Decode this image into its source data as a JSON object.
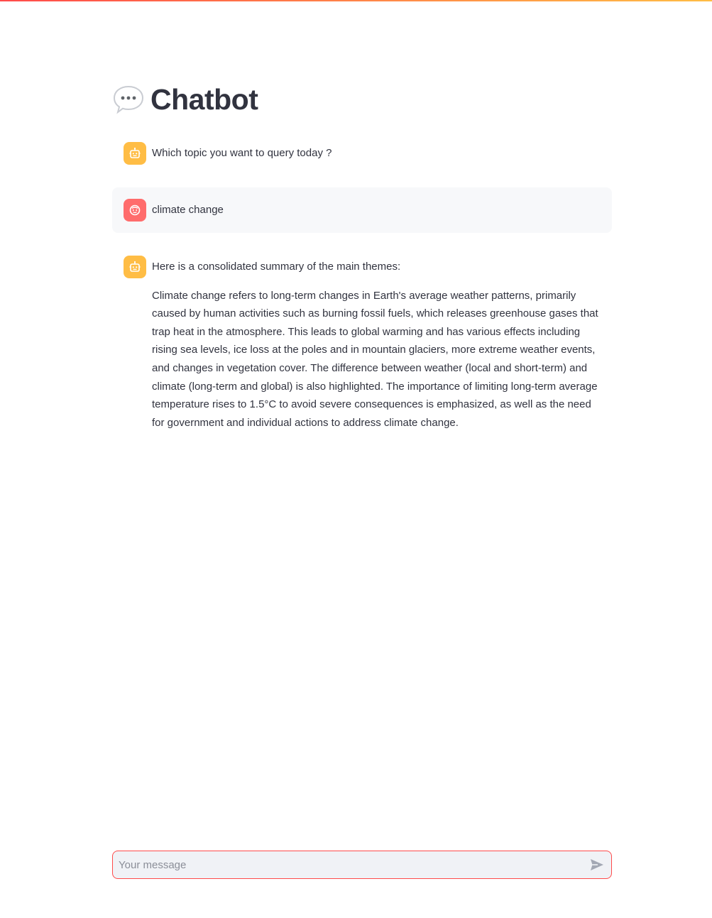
{
  "app": {
    "title_emoji_icon": "speech-bubble-icon",
    "title": "Chatbot"
  },
  "theme": {
    "accent": "#ff4b4b",
    "bot_avatar_color": "#ffbd45",
    "user_avatar_color": "#ff6c6c",
    "user_message_bg": "#f7f8fa",
    "input_bg": "#f0f2f6"
  },
  "messages": [
    {
      "role": "assistant",
      "avatar_icon": "robot-icon",
      "paragraphs": [
        "Which topic you want to query today ?"
      ]
    },
    {
      "role": "user",
      "avatar_icon": "smiley-face-icon",
      "paragraphs": [
        "climate change"
      ]
    },
    {
      "role": "assistant",
      "avatar_icon": "robot-icon",
      "paragraphs": [
        "Here is a consolidated summary of the main themes:",
        "Climate change refers to long-term changes in Earth's average weather patterns, primarily caused by human activities such as burning fossil fuels, which releases greenhouse gases that trap heat in the atmosphere. This leads to global warming and has various effects including rising sea levels, ice loss at the poles and in mountain glaciers, more extreme weather events, and changes in vegetation cover. The difference between weather (local and short-term) and climate (long-term and global) is also highlighted. The importance of limiting long-term average temperature rises to 1.5°C to avoid severe consequences is emphasized, as well as the need for government and individual actions to address climate change."
      ]
    }
  ],
  "chat_input": {
    "placeholder": "Your message",
    "value": "",
    "send_icon": "send-arrow-icon"
  }
}
